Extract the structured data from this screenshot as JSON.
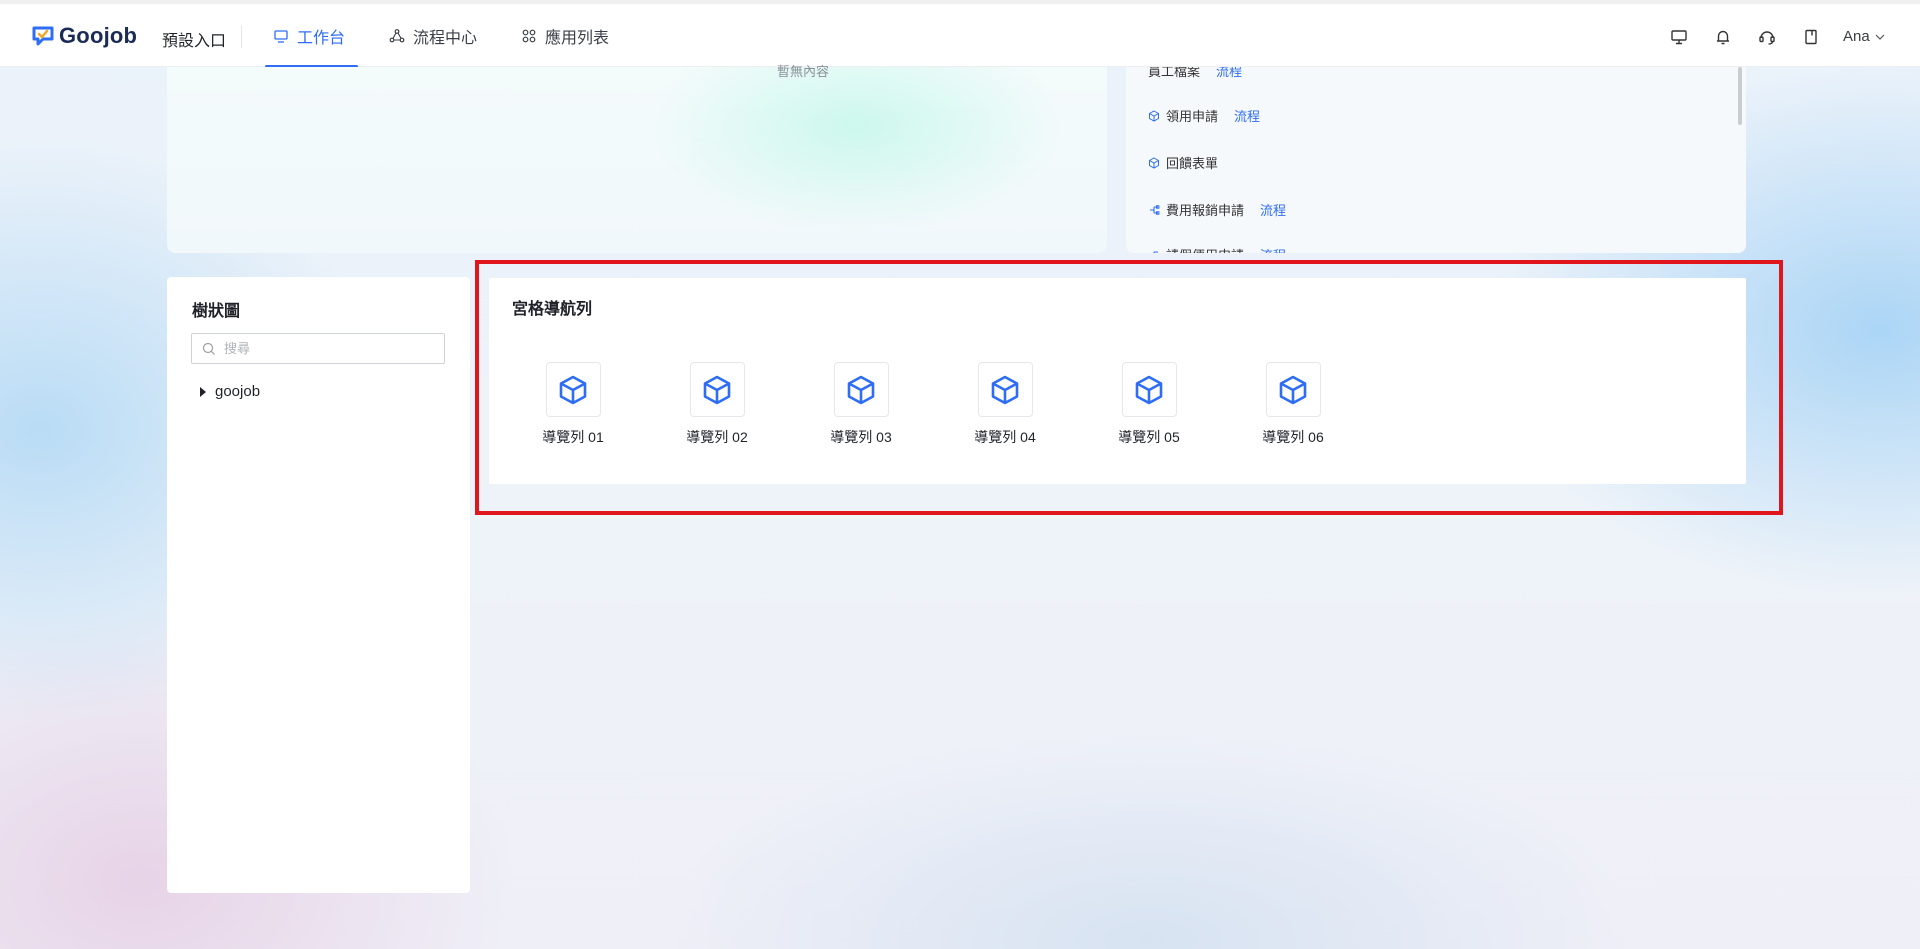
{
  "header": {
    "logo_text": "Goojob",
    "entry_label": "預設入口",
    "nav": [
      {
        "label": "工作台",
        "icon": "monitor-icon",
        "active": true
      },
      {
        "label": "流程中心",
        "icon": "flow-nodes-icon",
        "active": false
      },
      {
        "label": "應用列表",
        "icon": "apps-grid-icon",
        "active": false
      }
    ],
    "right_icons": [
      "desktop-icon",
      "bell-icon",
      "headset-icon",
      "bookmark-icon"
    ],
    "user_name": "Ana"
  },
  "empty_card": {
    "empty_text": "暫無內容"
  },
  "flows_card": {
    "items": [
      {
        "label": "員工檔案",
        "tag": "流程"
      },
      {
        "label": "領用申請",
        "tag": "流程"
      },
      {
        "label": "回饋表單",
        "tag": ""
      },
      {
        "label": "費用報銷申請",
        "tag": "流程"
      },
      {
        "label": "請假便用申請",
        "tag": "流程"
      }
    ]
  },
  "tree": {
    "title": "樹狀圖",
    "search_placeholder": "搜尋",
    "root_label": "goojob"
  },
  "grid_nav": {
    "title": "宮格導航列",
    "items": [
      "導覽列 01",
      "導覽列 02",
      "導覽列 03",
      "導覽列 04",
      "導覽列 05",
      "導覽列 06"
    ]
  },
  "colors": {
    "accent": "#2f6df6",
    "highlight_border": "#e0161c"
  }
}
